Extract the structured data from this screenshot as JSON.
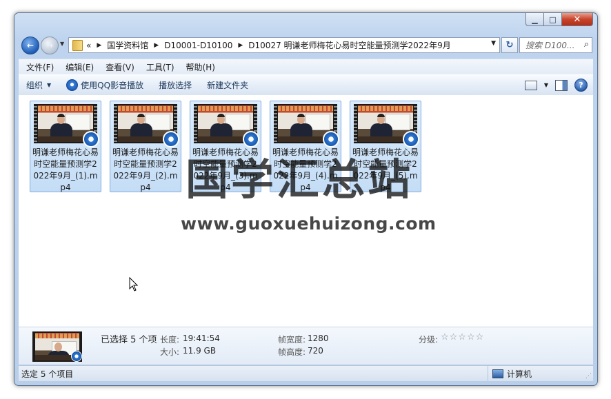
{
  "window": {
    "caption": {
      "minimize": "▁",
      "maximize": "□",
      "close": "✕"
    }
  },
  "nav": {
    "back_glyph": "←",
    "forward_glyph": "→",
    "overflow": "«",
    "breadcrumbs": [
      "国学资料馆",
      "D10001-D10100",
      "D10027 明谦老师梅花心易时空能量预测学2022年9月"
    ],
    "refresh_glyph": "↻",
    "search_placeholder": "搜索 D100..."
  },
  "menubar": [
    "文件(F)",
    "编辑(E)",
    "查看(V)",
    "工具(T)",
    "帮助(H)"
  ],
  "toolbar": {
    "organize": "组织",
    "play_qq": "使用QQ影音播放",
    "play_selection": "播放选择",
    "new_folder": "新建文件夹",
    "help": "?"
  },
  "files": [
    {
      "name": "明谦老师梅花心易时空能量预测学2022年9月_(1).mp4"
    },
    {
      "name": "明谦老师梅花心易时空能量预测学2022年9月_(2).mp4"
    },
    {
      "name": "明谦老师梅花心易时空能量预测学2022年9月_(3).mp4"
    },
    {
      "name": "明谦老师梅花心易时空能量预测学2022年9月_(4).mp4"
    },
    {
      "name": "明谦老师梅花心易时空能量预测学2022年9月_(5).mp4"
    }
  ],
  "watermark": {
    "title": "国学汇总站",
    "url": "www.guoxuehuizong.com"
  },
  "details": {
    "selected": "已选择 5 个项",
    "length_label": "长度:",
    "length_value": "19:41:54",
    "size_label": "大小:",
    "size_value": "11.9 GB",
    "frame_width_label": "帧宽度:",
    "frame_width_value": "1280",
    "frame_height_label": "帧高度:",
    "frame_height_value": "720",
    "rating_label": "分级:",
    "rating_stars": "☆☆☆☆☆"
  },
  "statusbar": {
    "left": "选定 5 个项目",
    "right": "计算机"
  }
}
